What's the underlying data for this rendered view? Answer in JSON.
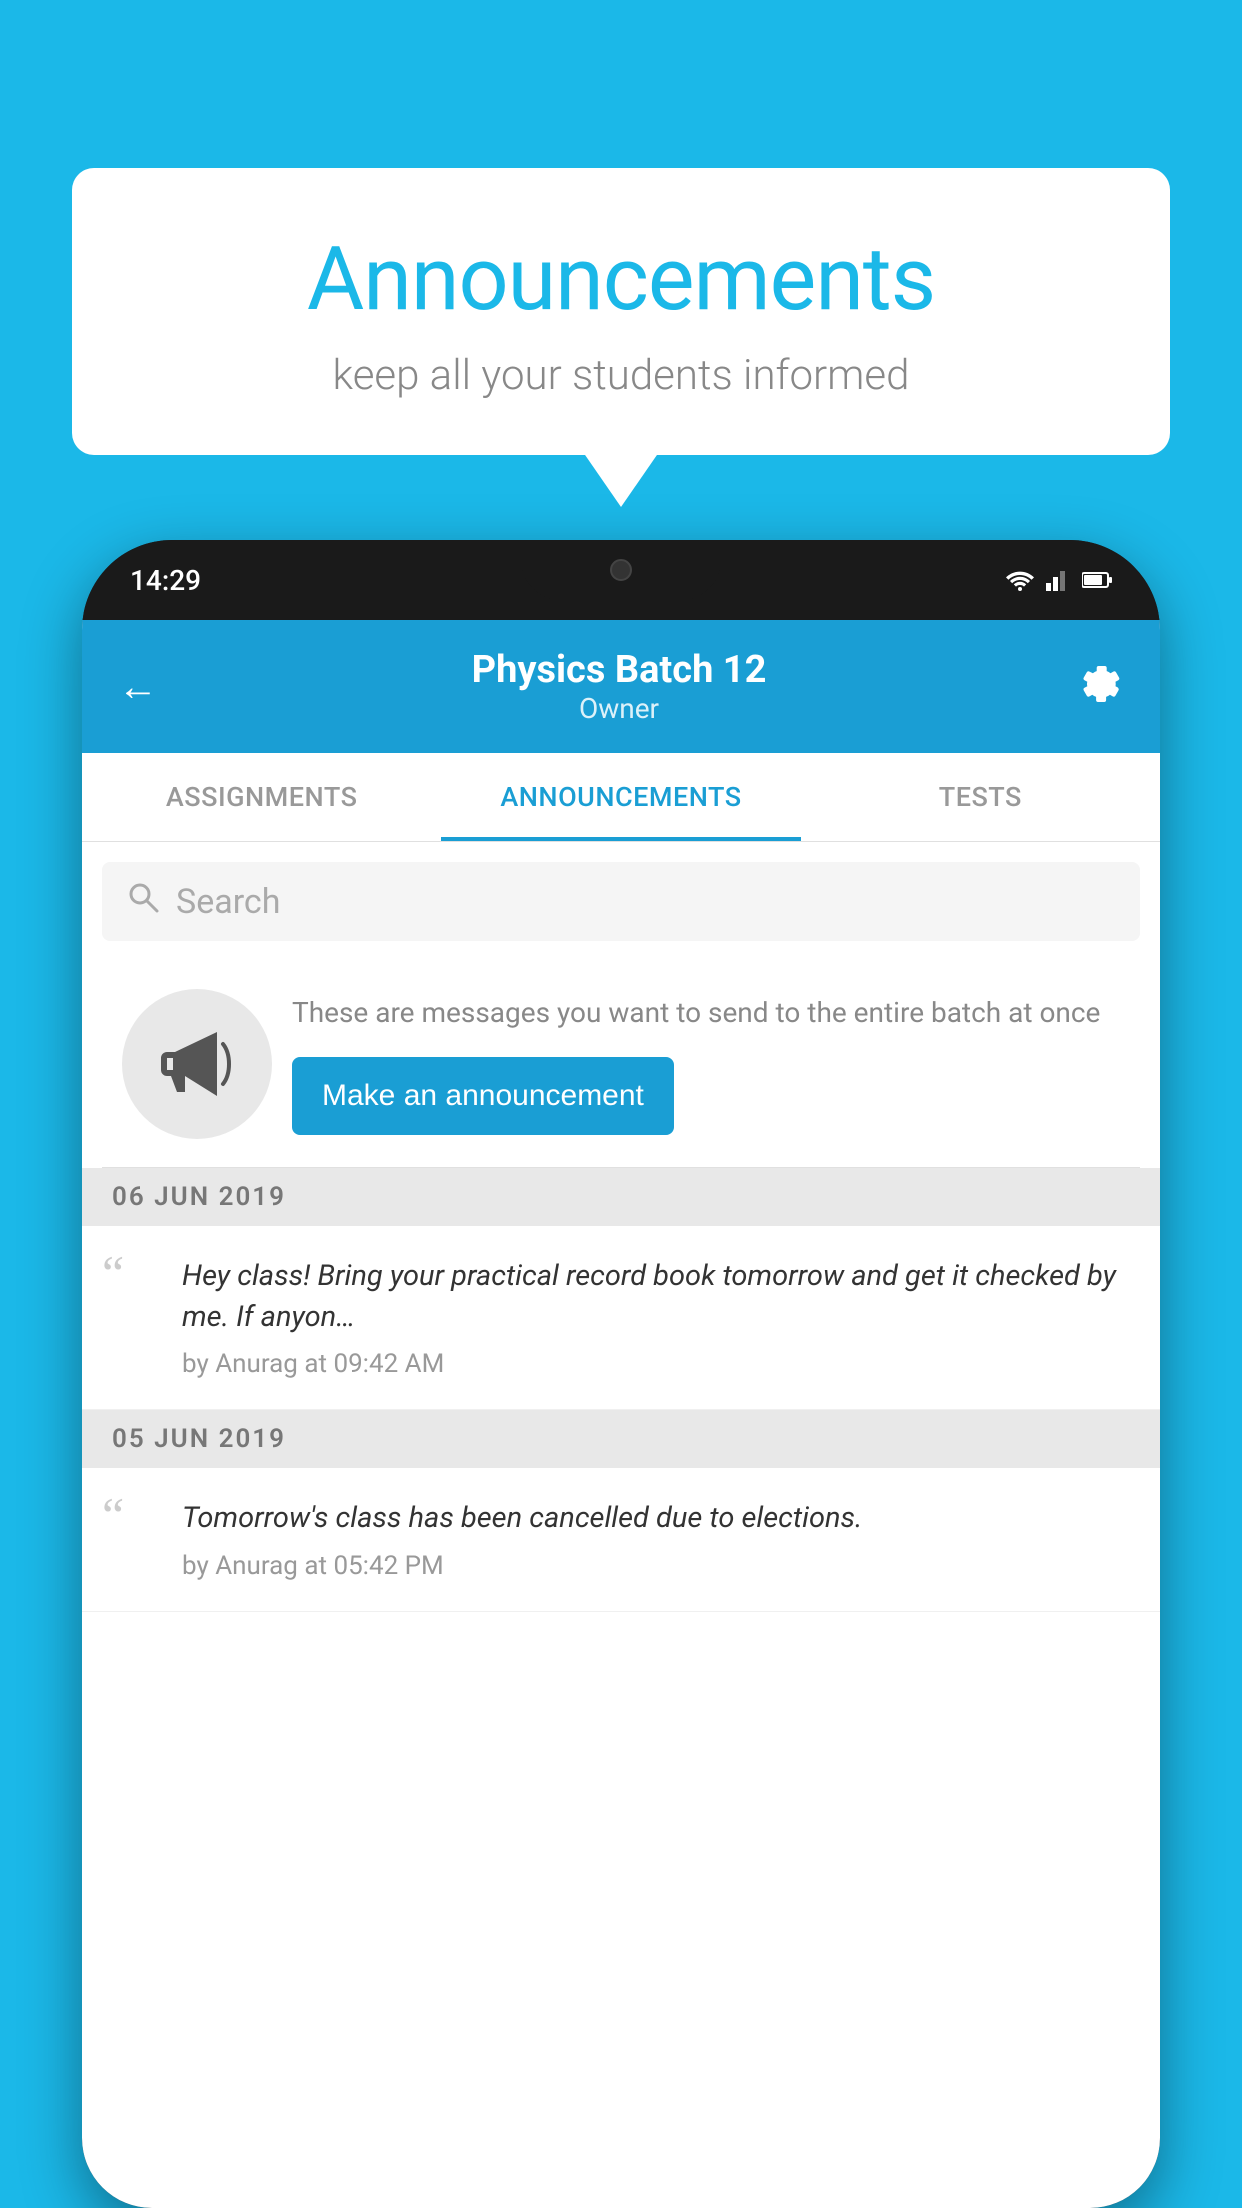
{
  "background_color": "#1bb8e8",
  "bubble": {
    "title": "Announcements",
    "subtitle": "keep all your students informed"
  },
  "phone": {
    "status_bar": {
      "time": "14:29"
    },
    "header": {
      "title": "Physics Batch 12",
      "subtitle": "Owner"
    },
    "tabs": [
      {
        "label": "ASSIGNMENTS",
        "active": false
      },
      {
        "label": "ANNOUNCEMENTS",
        "active": true
      },
      {
        "label": "TESTS",
        "active": false
      }
    ],
    "search": {
      "placeholder": "Search"
    },
    "promo": {
      "description": "These are messages you want to send to the entire batch at once",
      "button": "Make an announcement"
    },
    "announcements": [
      {
        "date": "06  JUN  2019",
        "text": "Hey class! Bring your practical record book tomorrow and get it checked by me. If anyon…",
        "author": "by Anurag at 09:42 AM"
      },
      {
        "date": "05  JUN  2019",
        "text": "Tomorrow's class has been cancelled due to elections.",
        "author": "by Anurag at 05:42 PM"
      }
    ]
  }
}
